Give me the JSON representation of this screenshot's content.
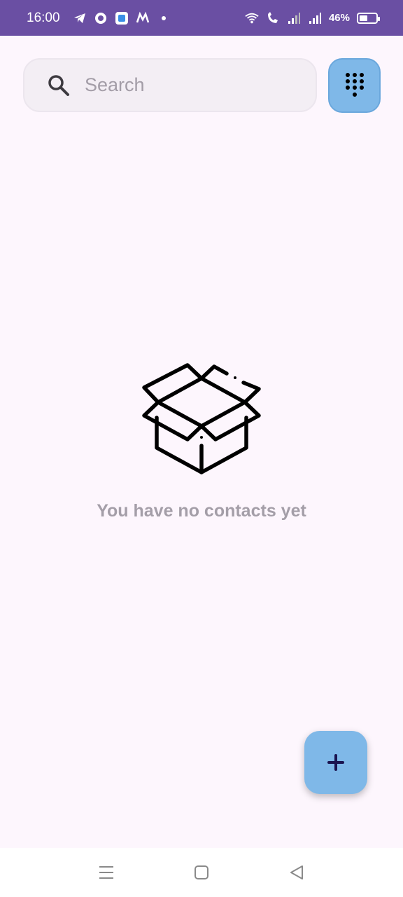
{
  "status_bar": {
    "time": "16:00",
    "battery_percent": "46%",
    "notification_icons": [
      "telegram-icon",
      "app-icon",
      "browser-icon",
      "m-app-icon",
      "dot-icon"
    ],
    "system_icons": [
      "wifi-icon",
      "volte-icon",
      "signal-icon",
      "signal-icon",
      "battery-icon"
    ]
  },
  "search": {
    "placeholder": "Search",
    "value": ""
  },
  "empty_state": {
    "message": "You have no contacts yet",
    "icon": "open-box-icon"
  },
  "buttons": {
    "dialpad": "dialpad-icon",
    "add": "plus-icon"
  },
  "nav": {
    "items": [
      "menu-icon",
      "home-icon",
      "back-icon"
    ]
  },
  "colors": {
    "status_bar": "#6a4fa3",
    "accent": "#7fb8e8",
    "background": "#fdf6fd",
    "muted_text": "#a49ea8"
  }
}
